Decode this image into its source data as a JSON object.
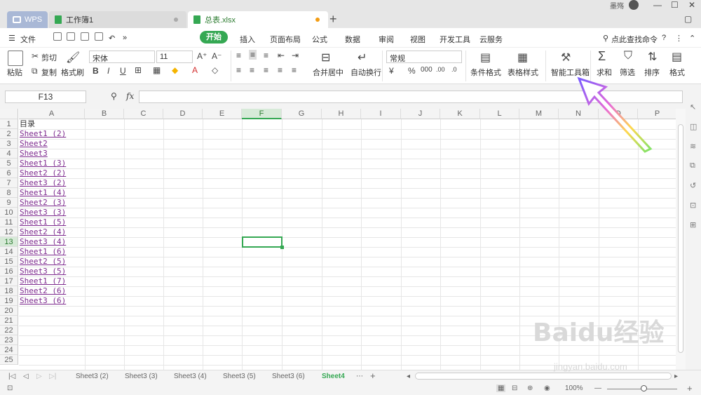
{
  "tabs": [
    {
      "label": "WPS"
    },
    {
      "label": "工作簿1"
    },
    {
      "label": "总表.xlsx"
    }
  ],
  "user_name": "墨殇",
  "menu": {
    "file": "文件",
    "start": "开始",
    "items": [
      "插入",
      "页面布局",
      "公式",
      "数据",
      "审阅",
      "视图",
      "开发工具",
      "云服务"
    ],
    "search": "点此查找命令"
  },
  "ribbon": {
    "paste": "粘贴",
    "cut": "剪切",
    "copy": "复制",
    "format_painter": "格式刷",
    "font": "宋体",
    "font_size": "11",
    "merge": "合并居中",
    "wrap": "自动换行",
    "number_format": "常规",
    "cond_format": "条件格式",
    "table_style": "表格样式",
    "smart_toolbox": "智能工具箱",
    "sum": "求和",
    "filter": "筛选",
    "sort": "排序",
    "format": "格式"
  },
  "formula": {
    "namebox": "F13",
    "fx": "fx",
    "value": ""
  },
  "columns": [
    "A",
    "B",
    "C",
    "D",
    "E",
    "F",
    "G",
    "H",
    "I",
    "J",
    "K",
    "L",
    "M",
    "N",
    "O",
    "P"
  ],
  "rows": [
    "1",
    "2",
    "3",
    "4",
    "5",
    "6",
    "7",
    "8",
    "9",
    "10",
    "11",
    "12",
    "13",
    "14",
    "15",
    "16",
    "17",
    "18",
    "19",
    "20",
    "21",
    "22",
    "23",
    "24",
    "25"
  ],
  "active_cell": "F13",
  "cells_A": [
    "目录",
    "Sheet1 (2)",
    "Sheet2",
    "Sheet3",
    "Sheet1 (3)",
    "Sheet2 (2)",
    "Sheet3 (2)",
    "Sheet1 (4)",
    "Sheet2 (3)",
    "Sheet3 (3)",
    "Sheet1 (5)",
    "Sheet2 (4)",
    "Sheet3 (4)",
    "Sheet1 (6)",
    "Sheet2 (5)",
    "Sheet3 (5)",
    "Sheet1 (7)",
    "Sheet2 (6)",
    "Sheet3 (6)"
  ],
  "sheet_tabs": [
    "Sheet3 (2)",
    "Sheet3 (3)",
    "Sheet3 (4)",
    "Sheet3 (5)",
    "Sheet3 (6)",
    "Sheet4"
  ],
  "active_sheet": "Sheet4",
  "zoom": "100%",
  "watermark": {
    "logo": "Baidu经验",
    "url": "jingyan.baidu.com"
  },
  "colors": {
    "accent": "#35a853",
    "link": "#7d2a8e"
  }
}
